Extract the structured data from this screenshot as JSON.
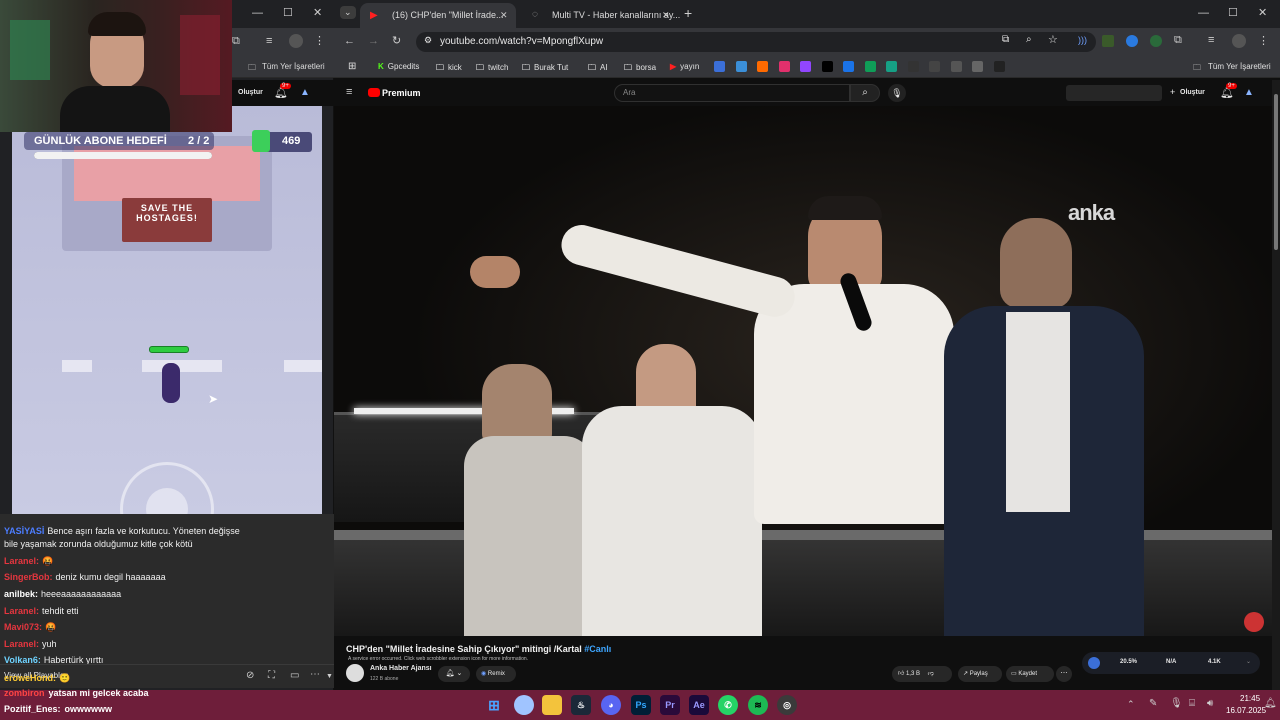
{
  "left_window": {
    "bookmarks_label": "Tüm Yer İşaretleri",
    "create_label": "Oluştur",
    "notif_count": "9+",
    "game": {
      "goal_label": "GÜNLÜK ABONE HEDEFİ",
      "goal_progress": "2 / 2",
      "goal_fraction": 1.0,
      "money_value": "469",
      "sign_text": "SAVE THE HOSTAGES!"
    },
    "chat": [
      {
        "user": "YASİYASİ",
        "user_color": "#4c7dff",
        "text": "Bence aşırı fazla ve korkutucu. Yöneten değişse"
      },
      {
        "user": "",
        "user_color": "#ffffff",
        "text": "bile yaşamak zorunda olduğumuz kitle çok kötü"
      },
      {
        "user": "Laranel:",
        "user_color": "#e5363f",
        "text": "🤬"
      },
      {
        "user": "SingerBob:",
        "user_color": "#e5363f",
        "text": "deniz kumu degil haaaaaaa"
      },
      {
        "user": "anilbek:",
        "user_color": "#ffffff",
        "text": "heeeaaaaaaaaaaaa"
      },
      {
        "user": "Laranel:",
        "user_color": "#e5363f",
        "text": "tehdit etti"
      },
      {
        "user": "Mavi073:",
        "user_color": "#e5363f",
        "text": "🤬"
      },
      {
        "user": "Laranel:",
        "user_color": "#e5363f",
        "text": "yuh"
      },
      {
        "user": "Volkan6:",
        "user_color": "#6fd3ff",
        "text": "Habertürk yırttı"
      },
      {
        "user": "eroweHond:",
        "user_color": "#ffcc33",
        "text": "🙂"
      }
    ],
    "chat_overlay": [
      {
        "user": "zombiron",
        "user_color": "#ff4444",
        "text": "yatsan mi gelcek acaba"
      },
      {
        "user": "Pozitif_Enes:",
        "user_color": "#ffffff",
        "text": "owwwwww"
      }
    ],
    "view_all_label": "View all Playables"
  },
  "right_window": {
    "tabs": [
      {
        "label": "(16) CHP'den \"Millet İrade...",
        "active": true
      },
      {
        "label": "Multi TV - Haber kanallarını ay...",
        "active": false
      }
    ],
    "url": "youtube.com/watch?v=MpongflXupw",
    "bookmarks": [
      {
        "label": "Gpcedits",
        "icon": "k-icon"
      },
      {
        "label": "kick",
        "icon": "folder-icon"
      },
      {
        "label": "twitch",
        "icon": "folder-icon"
      },
      {
        "label": "Burak Tut",
        "icon": "folder-icon"
      },
      {
        "label": "AI",
        "icon": "folder-icon"
      },
      {
        "label": "borsa",
        "icon": "folder-icon"
      },
      {
        "label": "yayın",
        "icon": "yt-icon"
      }
    ],
    "bookmarks_all_label": "Tüm Yer İşaretleri",
    "youtube": {
      "logo_label": "Premium",
      "search_placeholder": "Ara",
      "create_label": "Oluştur",
      "notif_count": "9+"
    },
    "video": {
      "watermark": "anka",
      "title": "CHP'den \"Millet İradesine Sahip Çıkıyor\" mitingi /Kartal",
      "title_tag": "#Canlı",
      "error_note": "A service error occurred. Click web scrobbler extension icon for more information.",
      "channel_name": "Anka Haber Ajansı",
      "subscribers": "122 B abone",
      "remix_label": "Remix",
      "like_count": "1,3 B",
      "share_label": "Paylaş",
      "save_label": "Kaydet",
      "stats": [
        "20.5%",
        "N/A",
        "4.1K"
      ]
    }
  },
  "taskbar": {
    "time": "21:45",
    "date": "16.07.2025"
  }
}
